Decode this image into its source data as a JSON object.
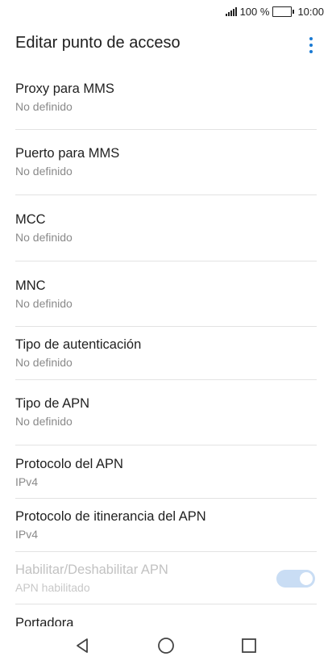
{
  "status_bar": {
    "battery_text": "100 %",
    "time": "10:00",
    "battery_level": 1.0
  },
  "header": {
    "title": "Editar punto de acceso",
    "menu_icon": "more-vert-icon",
    "accent_color": "#1a7ad3"
  },
  "settings": [
    {
      "label": "Proxy para MMS",
      "value": "No definido"
    },
    {
      "label": "Puerto para MMS",
      "value": "No definido"
    },
    {
      "label": "MCC",
      "value": "No definido"
    },
    {
      "label": "MNC",
      "value": "No definido"
    },
    {
      "label": "Tipo de autenticación",
      "value": "No definido"
    },
    {
      "label": "Tipo de APN",
      "value": "No definido"
    },
    {
      "label": "Protocolo del APN",
      "value": "IPv4"
    },
    {
      "label": "Protocolo de itinerancia del APN",
      "value": "IPv4"
    },
    {
      "label": "Habilitar/Deshabilitar APN",
      "value": "APN habilitado",
      "toggle_on": true,
      "disabled": true
    },
    {
      "label": "Portadora"
    }
  ],
  "nav": {
    "back_icon": "back-triangle-icon",
    "home_icon": "home-circle-icon",
    "recents_icon": "recents-square-icon"
  }
}
